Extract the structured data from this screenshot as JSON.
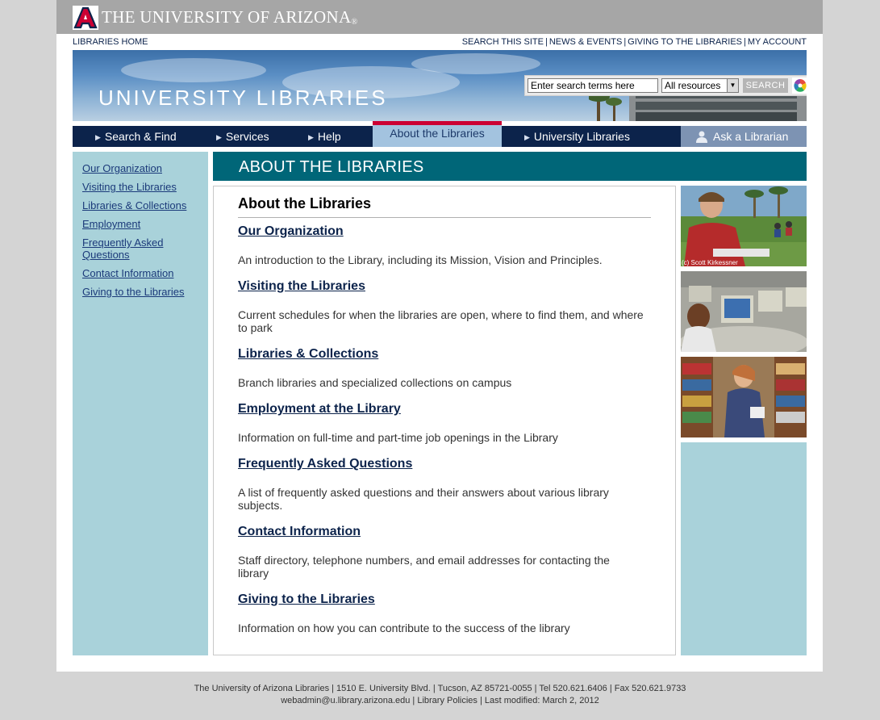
{
  "header": {
    "university_name": "THE UNIVERSITY OF ARIZONA",
    "registered_mark": "®",
    "logo_letter": "A"
  },
  "utility_nav": {
    "home_link": "LIBRARIES HOME",
    "links": [
      "SEARCH THIS SITE",
      "NEWS & EVENTS",
      "GIVING TO THE LIBRARIES",
      "MY ACCOUNT"
    ],
    "separator": "|"
  },
  "banner": {
    "title": "UNIVERSITY LIBRARIES"
  },
  "search": {
    "input_value": "Enter search terms here",
    "scope_selected": "All resources",
    "button_label": "SEARCH"
  },
  "main_nav": {
    "items": [
      "Search & Find",
      "Services",
      "Help",
      "About the Libraries",
      "University Libraries",
      "Ask a Librarian"
    ],
    "active": "About the Libraries"
  },
  "sidebar": {
    "items": [
      "Our Organization",
      "Visiting the Libraries",
      "Libraries & Collections",
      "Employment",
      "Frequently Asked Questions",
      "Contact Information",
      "Giving to the Libraries"
    ]
  },
  "section": {
    "title": "ABOUT THE LIBRARIES"
  },
  "content": {
    "heading": "About the Libraries",
    "items": [
      {
        "title": "Our Organization",
        "description": "An introduction to the Library, including its Mission, Vision and Principles."
      },
      {
        "title": "Visiting the Libraries",
        "description": "Current schedules for when the libraries are open, where to find them, and where to park"
      },
      {
        "title": "Libraries & Collections",
        "description": "Branch libraries and specialized collections on campus"
      },
      {
        "title": "Employment at the Library",
        "description": "Information on full-time and part-time job openings in the Library"
      },
      {
        "title": "Frequently Asked Questions",
        "description": "A list of frequently asked questions and their answers about various library subjects."
      },
      {
        "title": "Contact Information",
        "description": "Staff directory, telephone numbers, and email addresses for contacting the library"
      },
      {
        "title": "Giving to the Libraries",
        "description": "Information on how you can contribute to the success of the library"
      }
    ]
  },
  "photos": {
    "credit": "(c) Scott Kirkessner"
  },
  "footer": {
    "line1": "The University of Arizona Libraries | 1510 E. University Blvd. | Tucson, AZ 85721-0055 | Tel 520.621.6406 | Fax 520.621.9733",
    "line2": "webadmin@u.library.arizona.edu | Library Policies | Last modified: March 2, 2012"
  },
  "colors": {
    "navy": "#0c234b",
    "red": "#cc0033",
    "teal": "#006678",
    "light_teal": "#a9d2da",
    "active_tab": "#a3c3df",
    "ask_tab": "#7d93b3"
  }
}
